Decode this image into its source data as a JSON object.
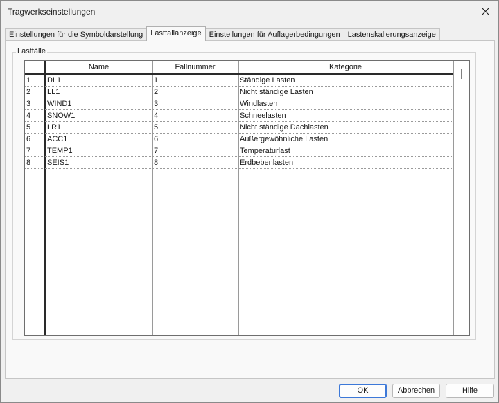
{
  "window": {
    "title": "Tragwerkseinstellungen"
  },
  "tabs": [
    {
      "label": "Einstellungen für die Symboldarstellung"
    },
    {
      "label": "Lastfallanzeige"
    },
    {
      "label": "Einstellungen für Auflagerbedingungen"
    },
    {
      "label": "Lastenskalierungsanzeige"
    }
  ],
  "group": {
    "label": "Lastfälle"
  },
  "table": {
    "headers": {
      "name": "Name",
      "number": "Fallnummer",
      "category": "Kategorie"
    },
    "rows": [
      {
        "index": "1",
        "name": "DL1",
        "number": "1",
        "category": "Ständige Lasten"
      },
      {
        "index": "2",
        "name": "LL1",
        "number": "2",
        "category": "Nicht ständige Lasten"
      },
      {
        "index": "3",
        "name": "WIND1",
        "number": "3",
        "category": "Windlasten"
      },
      {
        "index": "4",
        "name": "SNOW1",
        "number": "4",
        "category": "Schneelasten"
      },
      {
        "index": "5",
        "name": "LR1",
        "number": "5",
        "category": "Nicht ständige Dachlasten"
      },
      {
        "index": "6",
        "name": "ACC1",
        "number": "6",
        "category": "Außergewöhnliche Lasten"
      },
      {
        "index": "7",
        "name": "TEMP1",
        "number": "7",
        "category": "Temperaturlast"
      },
      {
        "index": "8",
        "name": "SEIS1",
        "number": "8",
        "category": "Erdbebenlasten"
      }
    ]
  },
  "buttons": {
    "ok": "OK",
    "cancel": "Abbrechen",
    "help": "Hilfe"
  },
  "colors": {
    "primary_border": "#3c78d8"
  }
}
